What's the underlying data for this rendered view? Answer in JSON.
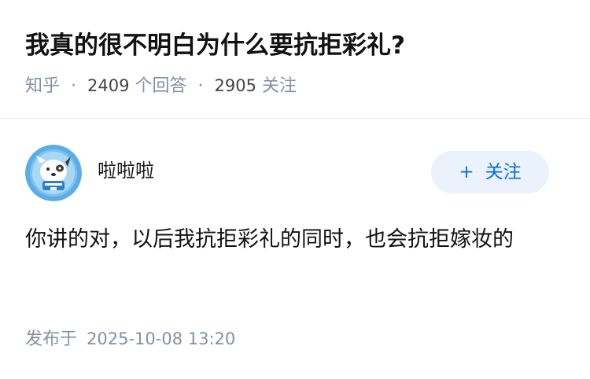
{
  "question": {
    "title": "我真的很不明白为什么要抗拒彩礼?",
    "source": "知乎",
    "separator": "·",
    "answer_count": "2409",
    "answer_label": "个回答",
    "follow_count": "2905",
    "follow_label": "关注"
  },
  "answer": {
    "author_name": "啦啦啦",
    "avatar_icon": "cartoon-dog-avatar",
    "follow_button_plus": "+",
    "follow_button_label": "关注",
    "content": "你讲的对，以后我抗拒彩礼的同时，也会抗拒嫁妆的",
    "publish_label": "发布于",
    "publish_time": "2025-10-08 13:20"
  },
  "colors": {
    "accent": "#056de8",
    "follow_bg": "#ebf2fb",
    "meta_gray": "#8590a6",
    "avatar_blue": "#5aaee5"
  }
}
